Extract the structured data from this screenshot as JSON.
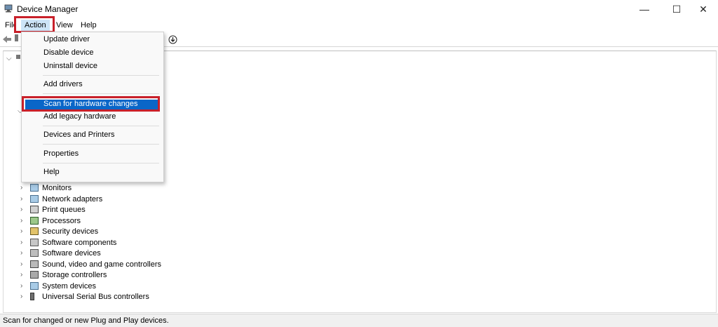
{
  "window": {
    "title": "Device Manager",
    "minimize": "—",
    "maximize": "☐",
    "close": "✕"
  },
  "menubar": {
    "file": "File",
    "action": "Action",
    "view": "View",
    "help": "Help"
  },
  "toolbar": {
    "back_icon": "arrow-left-icon",
    "download_icon": "arrow-down-circle-icon"
  },
  "action_menu": {
    "items": [
      {
        "label": "Update driver"
      },
      {
        "label": "Disable device"
      },
      {
        "label": "Uninstall device"
      },
      {
        "label": "Add drivers"
      },
      {
        "label": "Scan for hardware changes"
      },
      {
        "label": "Add legacy hardware"
      },
      {
        "label": "Devices and Printers"
      },
      {
        "label": "Properties"
      },
      {
        "label": "Help"
      }
    ],
    "highlighted": "Scan for hardware changes"
  },
  "tree": {
    "items": [
      {
        "label": "Monitors",
        "icon": "monitor-icon"
      },
      {
        "label": "Network adapters",
        "icon": "network-adapter-icon"
      },
      {
        "label": "Print queues",
        "icon": "printer-icon"
      },
      {
        "label": "Processors",
        "icon": "processor-icon"
      },
      {
        "label": "Security devices",
        "icon": "security-device-icon"
      },
      {
        "label": "Software components",
        "icon": "software-component-icon"
      },
      {
        "label": "Software devices",
        "icon": "software-device-icon"
      },
      {
        "label": "Sound, video and game controllers",
        "icon": "sound-icon"
      },
      {
        "label": "Storage controllers",
        "icon": "storage-icon"
      },
      {
        "label": "System devices",
        "icon": "system-device-icon"
      },
      {
        "label": "Universal Serial Bus controllers",
        "icon": "usb-icon"
      }
    ]
  },
  "status": {
    "text": "Scan for changed or new Plug and Play devices."
  },
  "colors": {
    "highlight_border": "#c8202a",
    "selection": "#0a66c8",
    "menu_active": "#cce4f7"
  }
}
